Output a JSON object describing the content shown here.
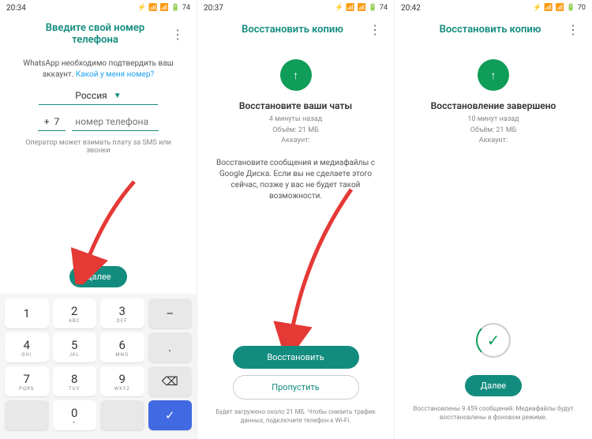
{
  "screen1": {
    "time": "20:34",
    "battery": "74",
    "title": "Введите свой номер телефона",
    "info_text": "WhatsApp необходимо подтвердить ваш аккаунт. ",
    "info_link": "Какой у меня номер?",
    "country": "Россия",
    "prefix_plus": "+",
    "prefix_code": "7",
    "phone_placeholder": "номер телефона",
    "note": "Оператор может взимать плату за SMS или звонки",
    "next_btn": "Далее",
    "keys": {
      "k1": "1",
      "k2": "2",
      "k2l": "ABC",
      "k3": "3",
      "k3l": "DEF",
      "k4": "4",
      "k4l": "GHI",
      "k5": "5",
      "k5l": "JKL",
      "k6": "6",
      "k6l": "MNO",
      "k7": "7",
      "k7l": "PQRS",
      "k8": "8",
      "k8l": "TUV",
      "k9": "9",
      "k9l": "WXYZ",
      "k0": "0",
      "k0l": "+",
      "dash": "–",
      "dot": ".",
      "back": "⌫",
      "check": "✓"
    }
  },
  "screen2": {
    "time": "20:37",
    "battery": "74",
    "title": "Восстановить копию",
    "restore_title": "Восстановите ваши чаты",
    "meta_time": "4 минуты назад",
    "meta_size": "Объём: 21 МБ",
    "meta_account": "Аккаунт:",
    "desc": "Восстановите сообщения и медиафайлы с Google Диска. Если вы не сделаете этого сейчас, позже у вас не будет такой возможности.",
    "restore_btn": "Восстановить",
    "skip_btn": "Пропустить",
    "bottom_note": "Будет загружено около 21 МБ. Чтобы снизить трафик данных, подключите телефон к Wi-Fi."
  },
  "screen3": {
    "time": "20:42",
    "battery": "70",
    "title": "Восстановить копию",
    "restore_title": "Восстановление завершено",
    "meta_time": "10 минут назад",
    "meta_size": "Объём: 21 МБ",
    "meta_account": "Аккаунт:",
    "next_btn": "Далее",
    "bottom_note": "Восстановлены 9 459 сообщений. Медиафайлы будут восстановлены в фоновом режиме."
  }
}
